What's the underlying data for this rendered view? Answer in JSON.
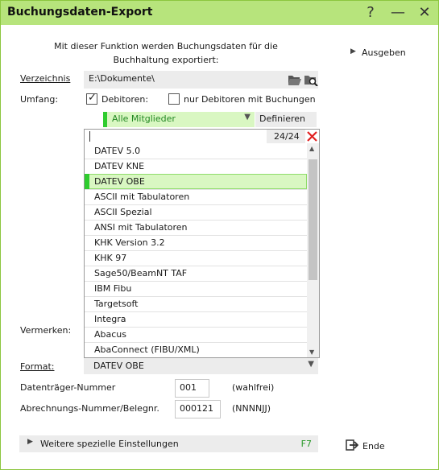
{
  "window": {
    "title": "Buchungsdaten-Export"
  },
  "intro": {
    "line1": "Mit dieser Funktion werden Buchungsdaten für die",
    "line2": "Buchhaltung exportiert:"
  },
  "verzeichnis": {
    "label": "Verzeichnis",
    "value": "E:\\Dokumente\\"
  },
  "umfang": {
    "label": "Umfang:",
    "debitoren_label": "Debitoren:",
    "debitoren_checked": true,
    "nur_label": "nur Debitoren mit Buchungen",
    "nur_checked": false
  },
  "member_select": {
    "value": "Alle Mitglieder",
    "define_label": "Definieren"
  },
  "dropdown": {
    "count": "24/24",
    "search_value": "",
    "selected_index": 2,
    "items": [
      "DATEV 5.0",
      "DATEV KNE",
      "DATEV OBE",
      "ASCII mit Tabulatoren",
      "ASCII Spezial",
      "ANSI mit Tabulatoren",
      "KHK Version 3.2",
      "KHK 97",
      "Sage50/BeamNT TAF",
      "IBM Fibu",
      "Targetsoft",
      "Integra",
      "Abacus",
      "AbaConnect (FIBU/XML)"
    ]
  },
  "vermerken": {
    "label": "Vermerken:"
  },
  "format": {
    "label": "Format:",
    "value": "DATEV OBE"
  },
  "datentraeger": {
    "label": "Datenträger-Nummer",
    "value": "001",
    "hint": "(wahlfrei)"
  },
  "abrechnung": {
    "label": "Abrechnungs-Nummer/Belegnr.",
    "value": "000121",
    "hint": "(NNNNJJ)"
  },
  "advanced": {
    "label": "Weitere spezielle Einstellungen",
    "shortcut": "F7"
  },
  "side": {
    "ausgeben": "Ausgeben",
    "ende": "Ende"
  },
  "colors": {
    "titlebar": "#b7e47c",
    "accent": "#2ecc2e",
    "selection": "#d9f7c2"
  }
}
